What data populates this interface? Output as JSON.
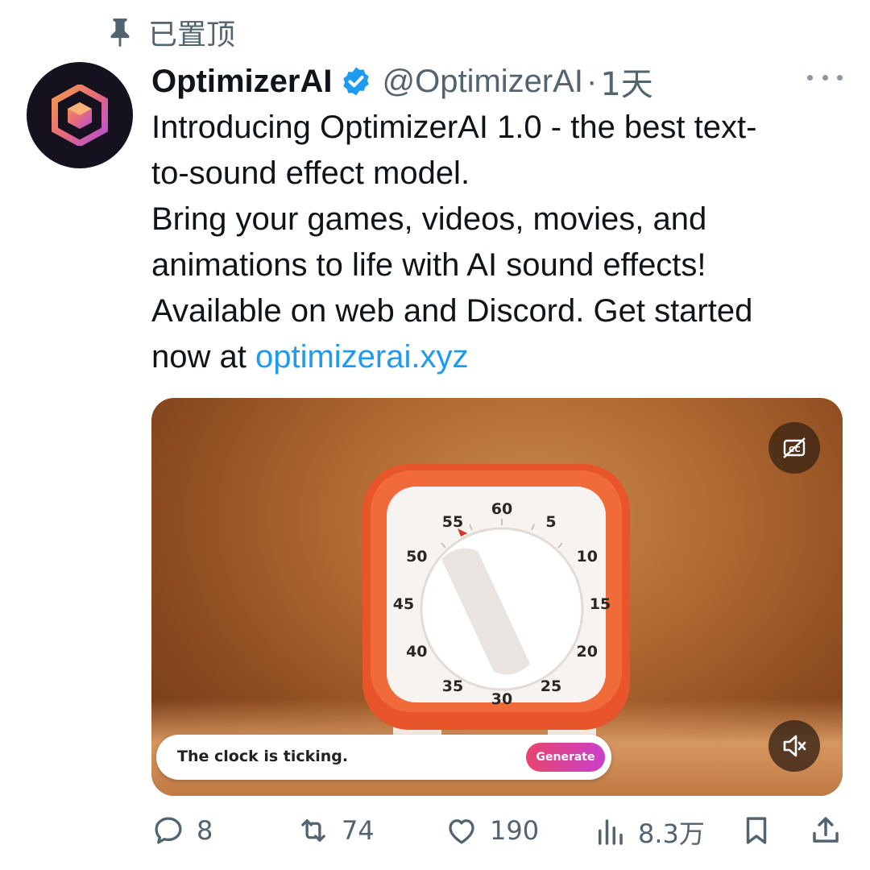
{
  "pinned": {
    "label": "已置顶",
    "icon": "pin-icon"
  },
  "author": {
    "name": "OptimizerAI",
    "handle": "@OptimizerAI",
    "separator": "·",
    "time": "1天",
    "verified_icon": "verified-badge-icon",
    "avatar_icon": "optimizerai-logo-icon"
  },
  "tweet": {
    "lines": [
      "Introducing OptimizerAI 1.0 - the best text-",
      "to-sound effect model.",
      "Bring your games, videos, movies, and",
      "animations to life with AI sound effects!",
      "Available on web and Discord. Get started"
    ],
    "last_line_prefix": "now at ",
    "link": "optimizerai.xyz"
  },
  "media": {
    "prompt_text": "The clock is ticking.",
    "generate_label": "Generate",
    "timer_numbers": [
      "60",
      "5",
      "10",
      "15",
      "20",
      "25",
      "30",
      "35",
      "40",
      "45",
      "50",
      "55"
    ],
    "cc_icon": "captions-off-icon",
    "mute_icon": "volume-muted-icon"
  },
  "actions": {
    "reply": {
      "icon": "reply-icon",
      "count": "8"
    },
    "retweet": {
      "icon": "retweet-icon",
      "count": "74"
    },
    "like": {
      "icon": "heart-icon",
      "count": "190"
    },
    "views": {
      "icon": "views-icon",
      "count": "8.3万"
    },
    "bookmark": {
      "icon": "bookmark-icon"
    },
    "share": {
      "icon": "share-icon"
    }
  },
  "colors": {
    "link": "#1d9bf0",
    "secondary_text": "#536471",
    "verified": "#1d9bf0",
    "timer_body": "#e8552a"
  }
}
